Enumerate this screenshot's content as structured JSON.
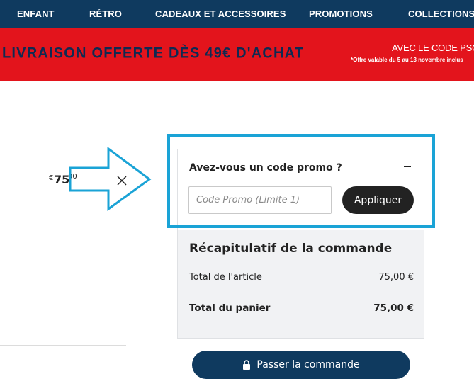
{
  "nav": {
    "items": [
      {
        "label": "ENFANT"
      },
      {
        "label": "RÉTRO"
      },
      {
        "label": "CADEAUX ET ACCESSOIRES"
      },
      {
        "label": "PROMOTIONS"
      },
      {
        "label": "COLLECTIONS"
      }
    ]
  },
  "banner": {
    "headline": "LIVRAISON OFFERTE DÈS 49€ D'ACHAT",
    "code_line": "AVEC LE CODE PSGIII",
    "fine_print": "*Offre valable du 5 au 13 novembre inclus"
  },
  "cart": {
    "price_currency": "€",
    "price_main": "75",
    "price_decimals": "00"
  },
  "promo": {
    "title": "Avez-vous un code promo ?",
    "input_placeholder": "Code Promo (Limite 1)",
    "input_value": "",
    "apply_label": "Appliquer"
  },
  "summary": {
    "title": "Récapitulatif de la commande",
    "rows": [
      {
        "label": "Total de l'article",
        "value": "75,00 €"
      },
      {
        "label": "Total du panier",
        "value": "75,00 €"
      }
    ],
    "checkout_label": "Passer la commande"
  },
  "colors": {
    "nav_bg": "#0f3a5f",
    "banner_bg": "#e3141c",
    "highlight": "#1aa3d6",
    "button_dark": "#222222"
  },
  "icons": [
    "close-icon",
    "minus-icon",
    "lock-icon",
    "arrow-annotation-icon"
  ]
}
